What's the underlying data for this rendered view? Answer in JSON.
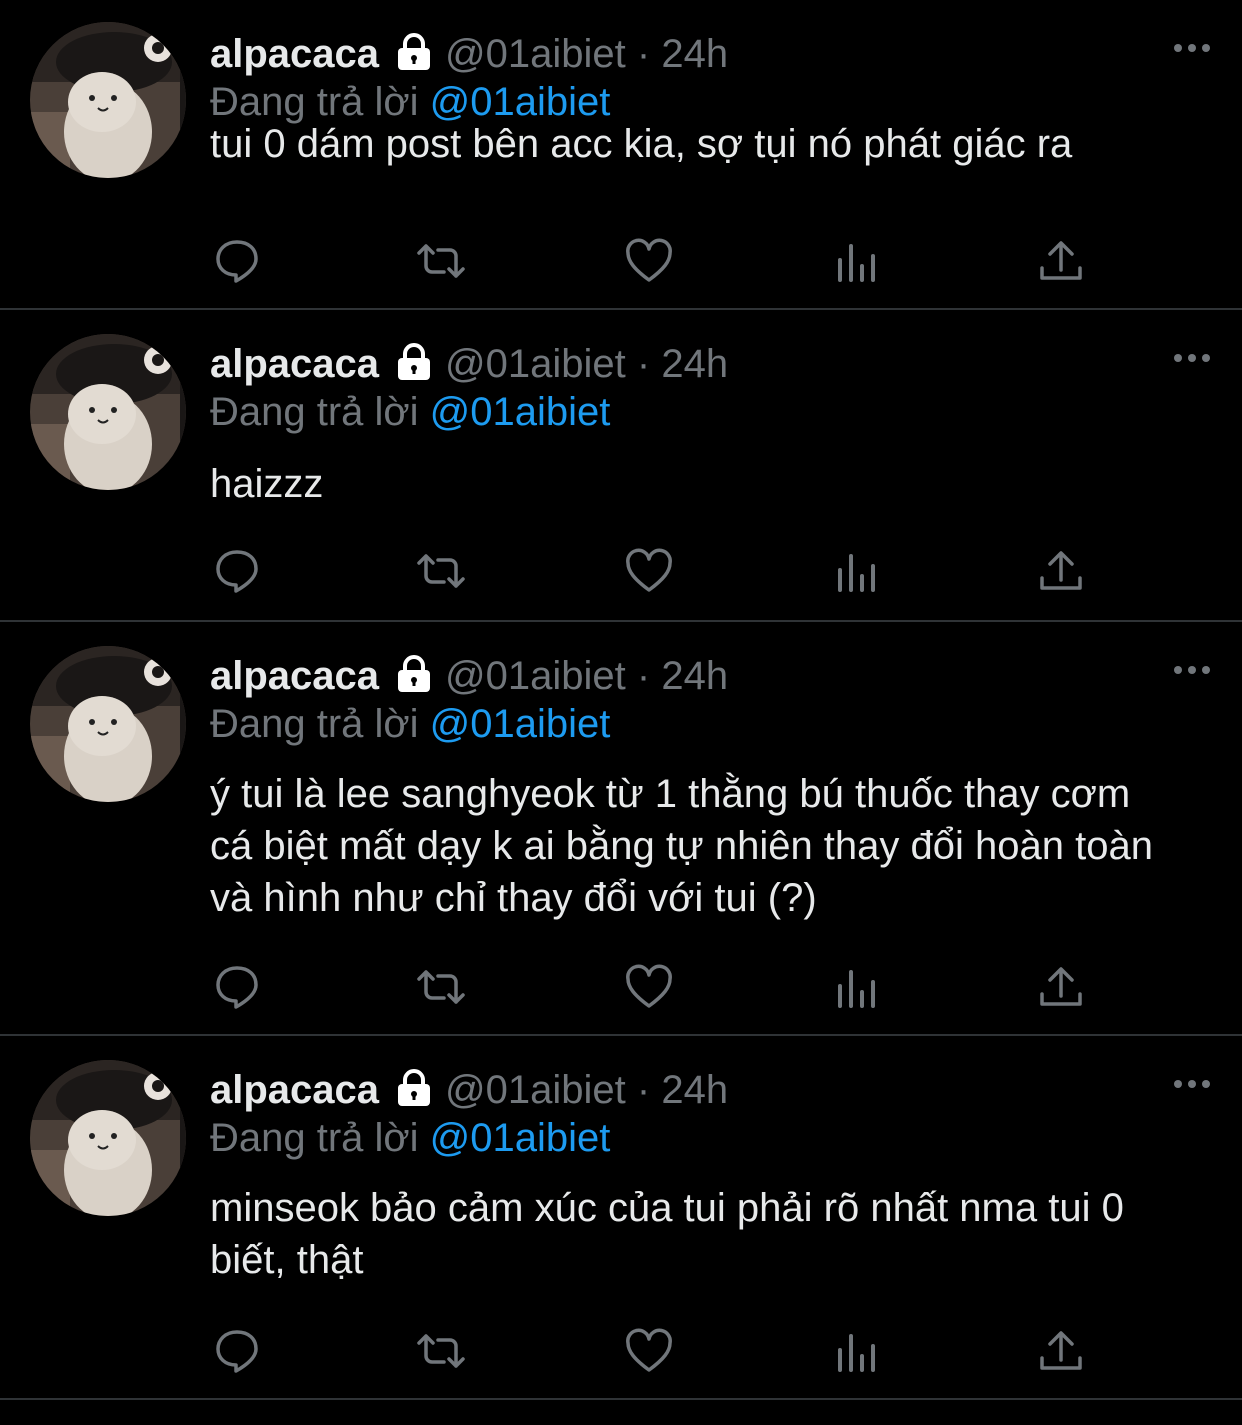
{
  "tweets": [
    {
      "display_name": "alpacaca",
      "handle": "@01aibiet",
      "separator": "·",
      "time": "24h",
      "reply_label": "Đang trả lời",
      "reply_mention": "@01aibiet",
      "text": "tui 0 dám post bên acc kia, sợ tụi nó phát giác ra"
    },
    {
      "display_name": "alpacaca",
      "handle": "@01aibiet",
      "separator": "·",
      "time": "24h",
      "reply_label": "Đang trả lời",
      "reply_mention": "@01aibiet",
      "text": "haizzz"
    },
    {
      "display_name": "alpacaca",
      "handle": "@01aibiet",
      "separator": "·",
      "time": "24h",
      "reply_label": "Đang trả lời",
      "reply_mention": "@01aibiet",
      "text": "ý tui là lee sanghyeok từ 1 thằng bú thuốc thay cơm cá biệt mất dạy k ai bằng tự nhiên thay đổi hoàn toàn và hình như chỉ thay đổi với tui (?)"
    },
    {
      "display_name": "alpacaca",
      "handle": "@01aibiet",
      "separator": "·",
      "time": "24h",
      "reply_label": "Đang trả lời",
      "reply_mention": "@01aibiet",
      "text": "minseok bảo cảm xúc của tui phải rõ nhất nma tui 0 biết, thật"
    }
  ],
  "icons": {
    "lock": "lock-icon",
    "more": "more-options-icon",
    "reply": "reply-icon",
    "retweet": "retweet-icon",
    "like": "like-icon",
    "analytics": "analytics-icon",
    "share": "share-icon"
  },
  "colors": {
    "background": "#000000",
    "text": "#e7e9ea",
    "secondary": "#71767b",
    "mention": "#1d9bf0",
    "divider": "#2f3336"
  }
}
